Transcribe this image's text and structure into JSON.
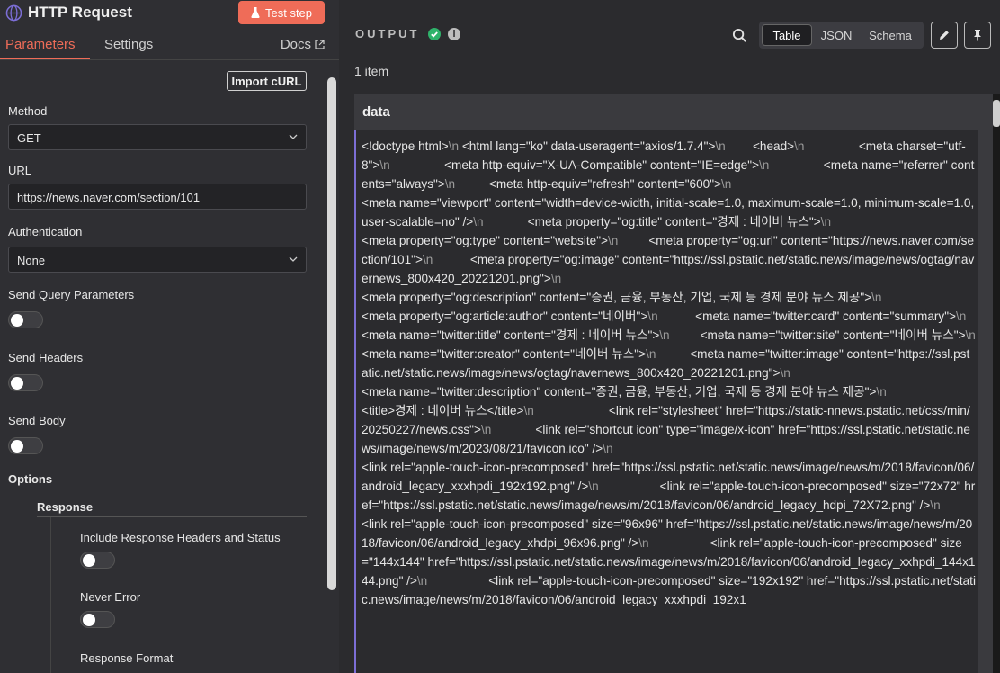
{
  "node": {
    "title": "HTTP Request",
    "test_step_label": "Test step"
  },
  "tabs": {
    "parameters": "Parameters",
    "settings": "Settings",
    "docs": "Docs"
  },
  "params": {
    "import_curl": "Import cURL",
    "method_label": "Method",
    "method_value": "GET",
    "url_label": "URL",
    "url_value": "https://news.naver.com/section/101",
    "auth_label": "Authentication",
    "auth_value": "None",
    "send_query_label": "Send Query Parameters",
    "send_headers_label": "Send Headers",
    "send_body_label": "Send Body",
    "options_label": "Options",
    "response_label": "Response",
    "include_headers_label": "Include Response Headers and Status",
    "never_error_label": "Never Error",
    "response_format_label": "Response Format"
  },
  "output": {
    "label": "OUTPUT",
    "views": [
      "Table",
      "JSON",
      "Schema"
    ],
    "active_view": "Table",
    "item_count": "1 item",
    "column": "data",
    "lines": [
      [
        "<!doctype html>",
        "\\n",
        " <html lang=\"ko\" data-useragent=\"axios/1.7.4\">",
        "\\n",
        "        <head>",
        "\\n",
        "                <meta charset=\"utf-8\">",
        "\\n",
        "                <meta http-equiv=\"X-UA-Compatible\" content=\"IE=edge\">",
        "\\n",
        "                <meta name=\"referrer\" contents=\"always\">",
        "\\n",
        "          <meta http-equiv=\"refresh\" content=\"600\">",
        "\\n"
      ],
      [
        "<meta name=\"viewport\" content=\"width=device-width, initial-scale=1.0, maximum-scale=1.0, minimum-scale=1.0, user-scalable=no\" />",
        "\\n",
        "             <meta property=\"og:title\" content=\"경제 : 네이버 뉴스\">",
        "\\n"
      ],
      [
        "<meta property=\"og:type\" content=\"website\">",
        "\\n",
        "         <meta property=\"og:url\" content=\"https://news.naver.com/section/101\">",
        "\\n",
        "           <meta property=\"og:image\" content=\"https://ssl.pstatic.net/static.news/image/news/ogtag/navernews_800x420_20221201.png\">",
        "\\n"
      ],
      [
        "<meta property=\"og:description\" content=\"증권, 금융, 부동산, 기업, 국제 등 경제 분야 뉴스 제공\">",
        "\\n"
      ],
      [
        "<meta property=\"og:article:author\" content=\"네이버\">",
        "\\n",
        "           <meta name=\"twitter:card\" content=\"summary\">",
        "\\n",
        "              <meta name=\"twitter:title\" content=\"경제 : 네이버 뉴스\">",
        "\\n",
        "         <meta name=\"twitter:site\" content=\"네이버 뉴스\">",
        "\\n",
        "                <meta name=\"twitter:creator\" content=\"네이버 뉴스\">",
        "\\n",
        "          <meta name=\"twitter:image\" content=\"https://ssl.pstatic.net/static.news/image/news/ogtag/navernews_800x420_20221201.png\">",
        "\\n"
      ],
      [
        "<meta name=\"twitter:description\" content=\"증권, 금융, 부동산, 기업, 국제 등 경제 분야 뉴스 제공\">",
        "\\n"
      ],
      [
        "<title>경제 : 네이버 뉴스</title>",
        "\\n",
        "                      <link rel=\"stylesheet\" href=\"https://static-nnews.pstatic.net/css/min/20250227/news.css\">",
        "\\n",
        "             <link rel=\"shortcut icon\" type=\"image/x-icon\" href=\"https://ssl.pstatic.net/static.news/image/news/m/2023/08/21/favicon.ico\" />",
        "\\n"
      ],
      [
        "<link rel=\"apple-touch-icon-precomposed\" href=\"https://ssl.pstatic.net/static.news/image/news/m/2018/favicon/06/android_legacy_xxxhpdi_192x192.png\" />",
        "\\n",
        "                  <link rel=\"apple-touch-icon-precomposed\" size=\"72x72\" href=\"https://ssl.pstatic.net/static.news/image/news/m/2018/favicon/06/android_legacy_hdpi_72X72.png\" />",
        "\\n",
        "                  <link rel=\"apple-touch-icon-precomposed\" size=\"96x96\" href=\"https://ssl.pstatic.net/static.news/image/news/m/2018/favicon/06/android_legacy_xhdpi_96x96.png\" />",
        "\\n",
        "                  <link rel=\"apple-touch-icon-precomposed\" size=\"144x144\" href=\"https://ssl.pstatic.net/static.news/image/news/m/2018/favicon/06/android_legacy_xxhpdi_144x144.png\" />",
        "\\n",
        "                  <link rel=\"apple-touch-icon-precomposed\" size=\"192x192\" href=\"https://ssl.pstatic.net/static.news/image/news/m/2018/favicon/06/android_legacy_xxxhpdi_192x1"
      ]
    ]
  },
  "colors": {
    "accent": "#ef6c58",
    "success": "#2fb36b",
    "row_marker": "#7c6ed6"
  },
  "icons": {
    "node": "globe-icon",
    "test": "flask-icon",
    "docs": "external-link-icon",
    "status": "check-circle-icon",
    "info": "info-icon",
    "search": "search-icon",
    "edit": "pencil-icon",
    "pin": "pin-icon"
  }
}
